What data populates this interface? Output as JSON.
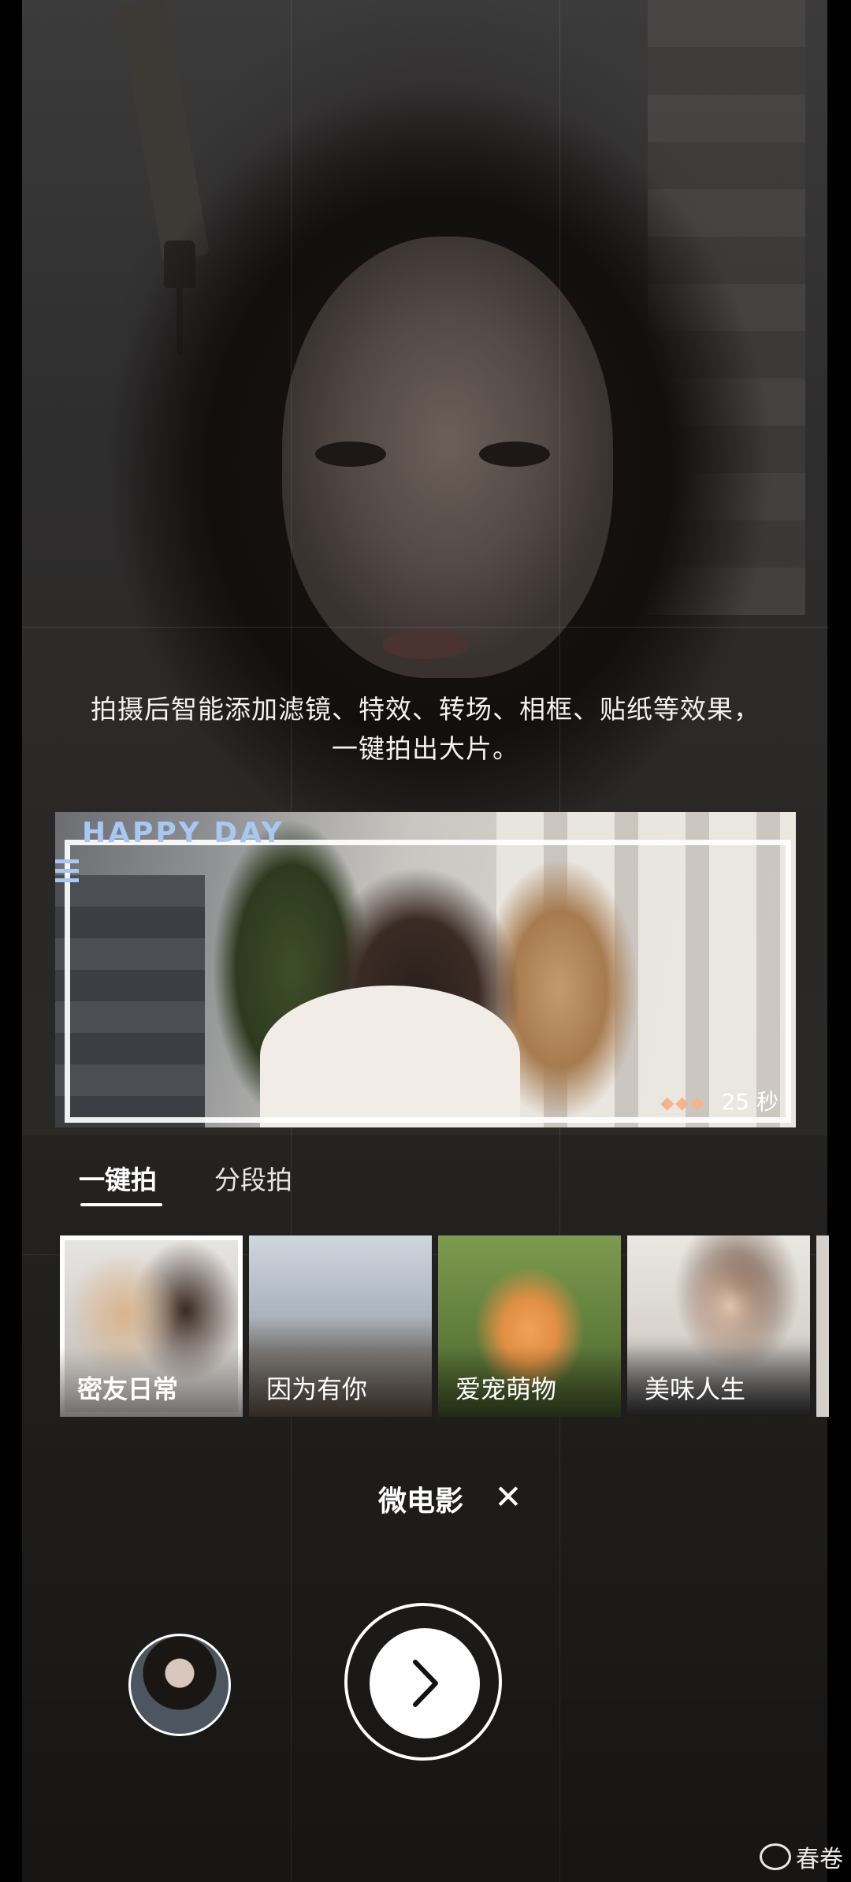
{
  "description": {
    "line1": "拍摄后智能添加滤镜、特效、转场、相框、贴纸等效果，",
    "line2": "一键拍出大片。"
  },
  "preview": {
    "frame_text": "HAPPY DAY",
    "duration": "25 秒",
    "hearts": "◆◆◆"
  },
  "tabs": [
    {
      "label": "一键拍",
      "active": true
    },
    {
      "label": "分段拍",
      "active": false
    }
  ],
  "templates": [
    {
      "label": "密友日常",
      "selected": true
    },
    {
      "label": "因为有你",
      "selected": false
    },
    {
      "label": "爱宠萌物",
      "selected": false
    },
    {
      "label": "美味人生",
      "selected": false
    }
  ],
  "mode": {
    "label": "微电影",
    "close": "✕"
  },
  "watermark": "春卷"
}
